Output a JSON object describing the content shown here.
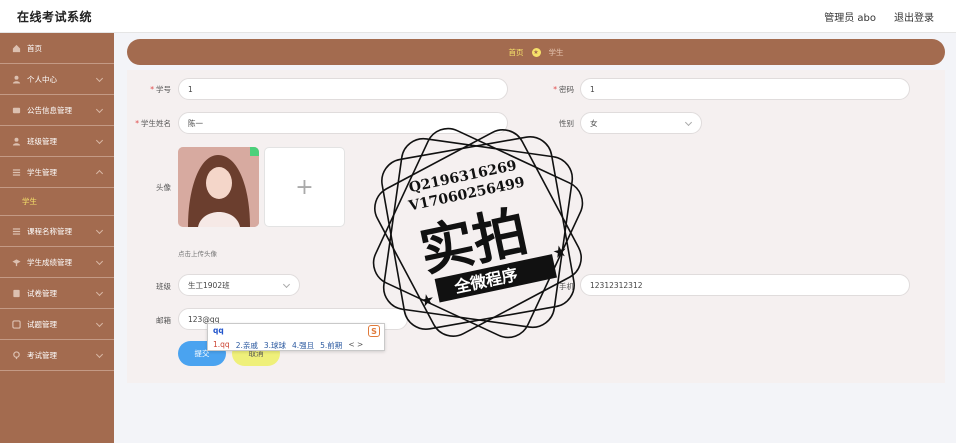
{
  "app": {
    "title": "在线考试系统"
  },
  "header": {
    "user_label": "管理员 abo",
    "logout_label": "退出登录"
  },
  "sidebar": {
    "items": [
      {
        "label": "首页",
        "icon": "home-icon",
        "expandable": false
      },
      {
        "label": "个人中心",
        "icon": "user-icon",
        "expandable": true
      },
      {
        "label": "公告信息管理",
        "icon": "notice-icon",
        "expandable": true
      },
      {
        "label": "班级管理",
        "icon": "user-icon",
        "expandable": true
      },
      {
        "label": "学生管理",
        "icon": "list-icon",
        "expandable": true,
        "expanded": true,
        "children": [
          {
            "label": "学生",
            "active": true
          }
        ]
      },
      {
        "label": "课程名称管理",
        "icon": "list-icon",
        "expandable": true
      },
      {
        "label": "学生成绩管理",
        "icon": "grad-icon",
        "expandable": true
      },
      {
        "label": "试卷管理",
        "icon": "paper-icon",
        "expandable": true
      },
      {
        "label": "试题管理",
        "icon": "question-icon",
        "expandable": true
      },
      {
        "label": "考试管理",
        "icon": "exam-icon",
        "expandable": true
      }
    ]
  },
  "breadcrumb": {
    "home": "首页",
    "current": "学生"
  },
  "form": {
    "student_id": {
      "label": "学号",
      "required": true,
      "value": "1"
    },
    "password": {
      "label": "密码",
      "required": true,
      "value": "1"
    },
    "student_name": {
      "label": "学生姓名",
      "required": true,
      "value": "陈一"
    },
    "gender": {
      "label": "性别",
      "value": "女"
    },
    "avatar": {
      "label": "头像",
      "upload_symbol": "+",
      "hint": "点击上传头像"
    },
    "class": {
      "label": "班级",
      "value": "生工1902班"
    },
    "phone": {
      "label": "手机",
      "value": "12312312312"
    },
    "email": {
      "label": "邮箱",
      "value": "123@qq"
    },
    "submit_label": "提交",
    "cancel_label": "取消"
  },
  "ime": {
    "composition": "qq",
    "candidates": [
      "1.qq",
      "2.亲戚",
      "3.球球",
      "4.强且",
      "5.前期"
    ],
    "nav": "< >",
    "logo": "S"
  },
  "watermark": {
    "line1": "Q2196316269",
    "line2": "V17060256499",
    "main": "实拍",
    "ribbon": "全微程序"
  },
  "colors": {
    "sidebar": "#a36b4f",
    "accent_yellow": "#f7e36a",
    "submit": "#4aa3f0",
    "cancel": "#eff07a",
    "panel": "#f5f0f0"
  }
}
